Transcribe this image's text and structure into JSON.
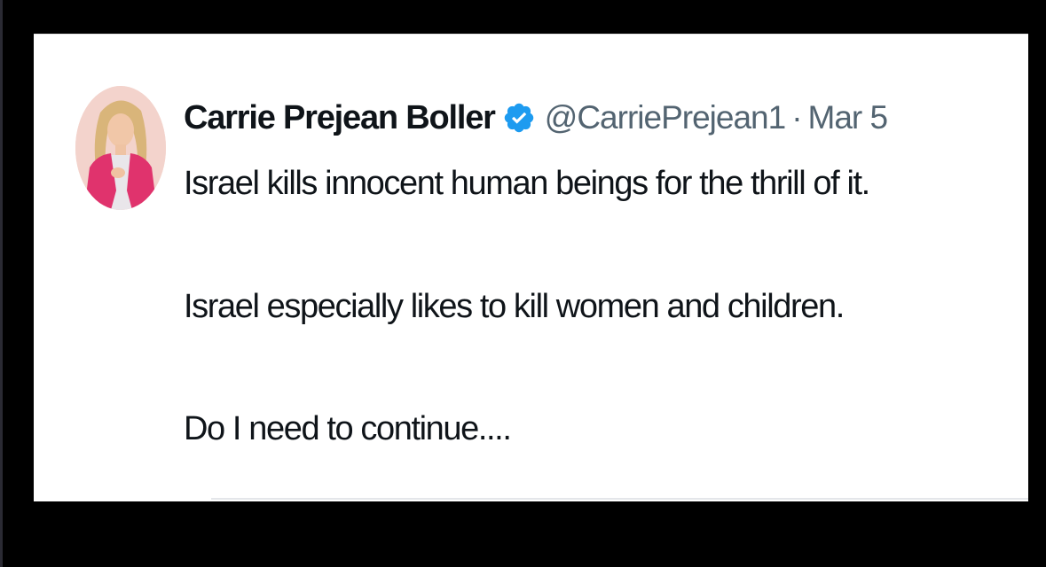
{
  "tweet": {
    "author": {
      "display_name": "Carrie Prejean Boller",
      "handle": "@CarriePrejean1",
      "verified_badge_icon": "verified-check-icon",
      "avatar_icon": "profile-photo-avatar",
      "verified_color": "#1d9bf0"
    },
    "separator": "·",
    "date": "Mar 5",
    "lines": [
      "Israel kills innocent human beings for the thrill of it.",
      "Israel especially likes to kill women and children.",
      "Do I need to continue...."
    ]
  }
}
